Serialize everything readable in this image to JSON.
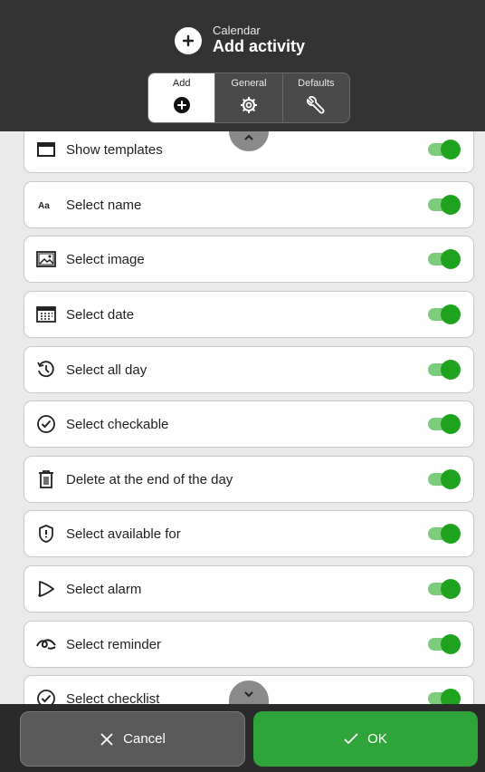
{
  "header": {
    "subtitle": "Calendar",
    "title": "Add activity",
    "icon": "plus-circle-icon"
  },
  "tabs": [
    {
      "label": "Add",
      "icon": "plus-circle-icon",
      "active": true
    },
    {
      "label": "General",
      "icon": "gear-icon",
      "active": false
    },
    {
      "label": "Defaults",
      "icon": "wrench-icon",
      "active": false
    }
  ],
  "rows": [
    {
      "label": "Show templates",
      "icon": "template-icon",
      "enabled": true
    },
    {
      "label": "Select name",
      "icon": "text-aa-icon",
      "enabled": true
    },
    {
      "label": "Select image",
      "icon": "image-icon",
      "enabled": true
    },
    {
      "label": "Select date",
      "icon": "calendar-icon",
      "enabled": true
    },
    {
      "label": "Select all day",
      "icon": "history-clock-icon",
      "enabled": true
    },
    {
      "label": "Select checkable",
      "icon": "check-circle-icon",
      "enabled": true
    },
    {
      "label": "Delete at the end of the day",
      "icon": "trash-icon",
      "enabled": true
    },
    {
      "label": "Select available for",
      "icon": "shield-icon",
      "enabled": true
    },
    {
      "label": "Select alarm",
      "icon": "alarm-bell-icon",
      "enabled": true
    },
    {
      "label": "Select reminder",
      "icon": "reminder-icon",
      "enabled": true
    },
    {
      "label": "Select checklist",
      "icon": "checklist-icon",
      "enabled": true
    }
  ],
  "footer": {
    "cancel_label": "Cancel",
    "ok_label": "OK"
  },
  "colors": {
    "header_bg": "#333333",
    "list_bg": "#eaeaea",
    "toggle_on": "#1fa31f",
    "ok_button": "#2fa43a",
    "cancel_button": "#5a5a5a"
  }
}
